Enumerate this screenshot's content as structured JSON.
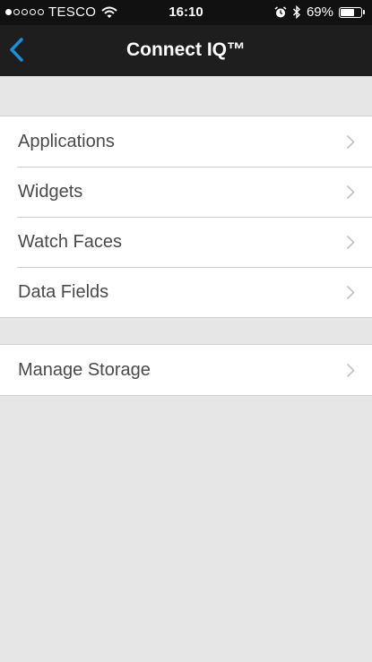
{
  "status_bar": {
    "signal_dots": [
      true,
      false,
      false,
      false,
      false
    ],
    "carrier": "TESCO",
    "time": "16:10",
    "battery_percent": "69%",
    "battery_level": 0.69,
    "icons": [
      "wifi-icon",
      "alarm-icon",
      "bluetooth-icon",
      "battery-icon"
    ]
  },
  "nav": {
    "title": "Connect IQ™",
    "back_icon": "chevron-left-icon"
  },
  "menu": {
    "group1": [
      {
        "label": "Applications"
      },
      {
        "label": "Widgets"
      },
      {
        "label": "Watch Faces"
      },
      {
        "label": "Data Fields"
      }
    ],
    "group2": [
      {
        "label": "Manage Storage"
      }
    ]
  },
  "colors": {
    "accent": "#1a8fd8",
    "navbar": "#1e1e1e",
    "background": "#e6e6e6"
  }
}
